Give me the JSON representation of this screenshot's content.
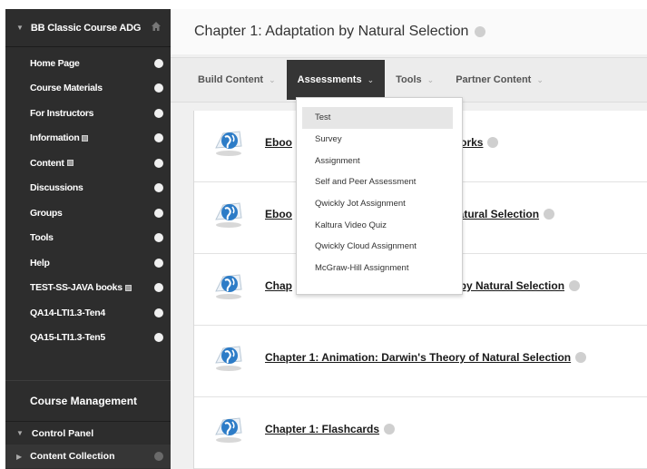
{
  "sidebar": {
    "course_title": "BB Classic Course ADG",
    "items": [
      {
        "label": "Home Page",
        "has_icon": false
      },
      {
        "label": "Course Materials",
        "has_icon": false
      },
      {
        "label": "For Instructors",
        "has_icon": false
      },
      {
        "label": "Information",
        "has_icon": true
      },
      {
        "label": "Content",
        "has_icon": true
      },
      {
        "label": "Discussions",
        "has_icon": false
      },
      {
        "label": "Groups",
        "has_icon": false
      },
      {
        "label": "Tools",
        "has_icon": false
      },
      {
        "label": "Help",
        "has_icon": false
      },
      {
        "label": "TEST-SS-JAVA books",
        "has_icon": true
      },
      {
        "label": "QA14-LTI1.3-Ten4",
        "has_icon": false
      },
      {
        "label": "QA15-LTI1.3-Ten5",
        "has_icon": false
      }
    ],
    "course_management_title": "Course Management",
    "control_panel_label": "Control Panel",
    "content_collection_label": "Content Collection"
  },
  "page": {
    "title": "Chapter 1: Adaptation by Natural Selection"
  },
  "action_bar": {
    "items": [
      {
        "label": "Build Content",
        "active": false
      },
      {
        "label": "Assessments",
        "active": true
      },
      {
        "label": "Tools",
        "active": false
      },
      {
        "label": "Partner Content",
        "active": false
      }
    ]
  },
  "assessments_menu": {
    "options": [
      "Test",
      "Survey",
      "Assignment",
      "Self and Peer Assessment",
      "Qwickly Jot Assignment",
      "Kaltura Video Quiz",
      "Qwickly Cloud Assignment",
      "McGraw-Hill Assignment"
    ],
    "highlighted_index": 0
  },
  "content_items": [
    {
      "prefix": "Eboo",
      "suffix": "Works"
    },
    {
      "prefix": "Eboo",
      "suffix": "Natural Selection"
    },
    {
      "prefix": "Chap",
      "suffix": "n by Natural Selection"
    },
    {
      "prefix": "",
      "suffix": "Chapter 1: Animation: Darwin's Theory of Natural Selection"
    },
    {
      "prefix": "",
      "suffix": "Chapter 1: Flashcards"
    }
  ],
  "colors": {
    "sidebar_bg": "#2d2d2d",
    "active_tab_bg": "#353535",
    "link_color": "#1a1a1a",
    "icon_blue": "#2d7cc7"
  },
  "icons": {
    "course_header": "home-icon",
    "content_item": "web-link-globe-icon"
  }
}
